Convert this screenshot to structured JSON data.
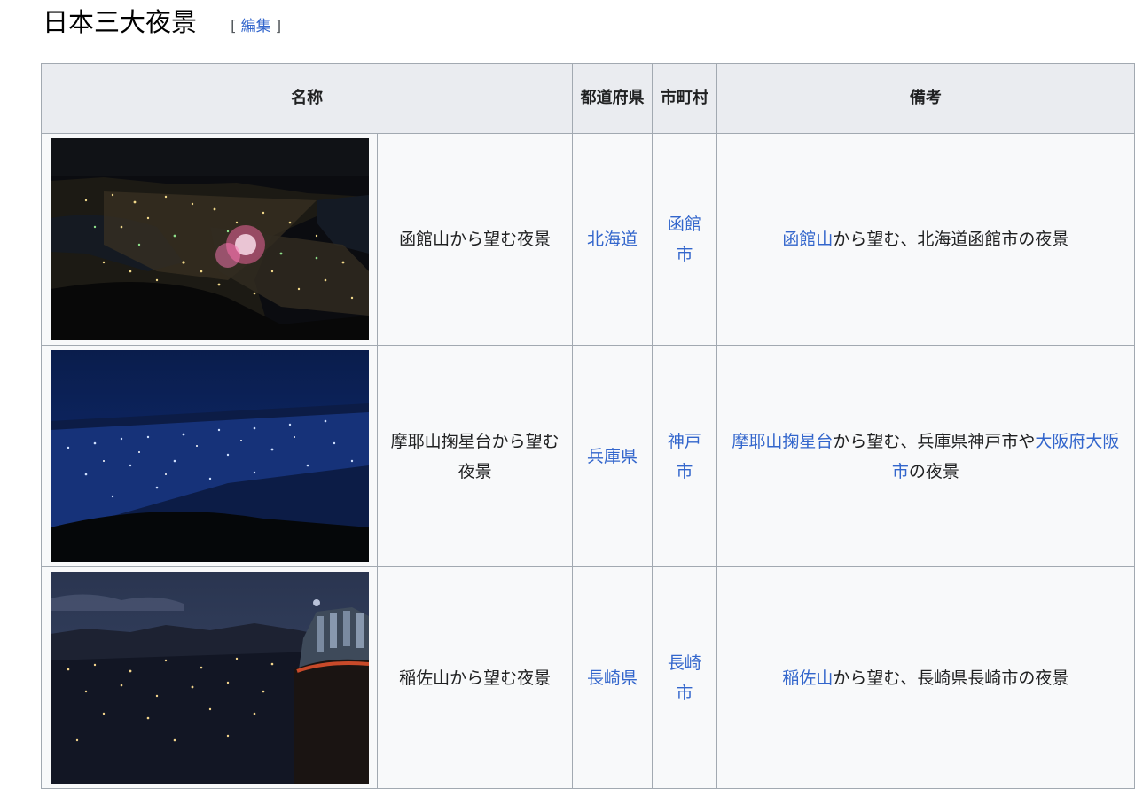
{
  "heading": {
    "title": "日本三大夜景",
    "edit_open": "[",
    "edit_label": "編集",
    "edit_close": "]"
  },
  "table": {
    "headers": {
      "name": "名称",
      "prefecture": "都道府県",
      "municipality": "市町村",
      "remarks": "備考"
    },
    "rows": [
      {
        "image_alt": "函館山からの夜景写真",
        "name": "函館山から望む夜景",
        "prefecture": "北海道",
        "municipality": "函館市",
        "remarks_link": "函館山",
        "remarks_text": "から望む、北海道函館市の夜景"
      },
      {
        "image_alt": "摩耶山掬星台からの夜景写真",
        "name": "摩耶山掬星台から望む夜景",
        "prefecture": "兵庫県",
        "municipality": "神戸市",
        "remarks_link": "摩耶山掬星台",
        "remarks_text": "から望む、兵庫県神戸市や",
        "remarks_link2": "大阪府大阪市",
        "remarks_text2": "の夜景"
      },
      {
        "image_alt": "稲佐山からの夜景写真",
        "name": "稲佐山から望む夜景",
        "prefecture": "長崎県",
        "municipality": "長崎市",
        "remarks_link": "稲佐山",
        "remarks_text": "から望む、長崎県長崎市の夜景"
      }
    ]
  },
  "colors": {
    "link": "#3366cc",
    "header_bg": "#eaecf0",
    "cell_bg": "#f8f9fa",
    "border": "#a2a9b1"
  }
}
